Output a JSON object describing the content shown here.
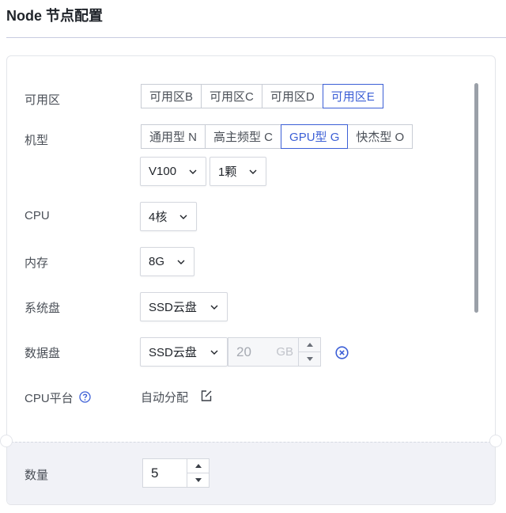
{
  "header": {
    "title": "Node 节点配置"
  },
  "zone": {
    "label": "可用区",
    "options": [
      "可用区B",
      "可用区C",
      "可用区D",
      "可用区E"
    ],
    "selected": "可用区E"
  },
  "instance_type": {
    "label": "机型",
    "options": [
      "通用型 N",
      "高主频型 C",
      "GPU型 G",
      "快杰型 O"
    ],
    "selected": "GPU型 G",
    "gpu_model": "V100",
    "gpu_count": "1颗"
  },
  "cpu": {
    "label": "CPU",
    "value": "4核"
  },
  "memory": {
    "label": "内存",
    "value": "8G"
  },
  "system_disk": {
    "label": "系统盘",
    "type": "SSD云盘"
  },
  "data_disk": {
    "label": "数据盘",
    "type": "SSD云盘",
    "size": "20",
    "unit": "GB"
  },
  "cpu_platform": {
    "label": "CPU平台",
    "value": "自动分配"
  },
  "quantity": {
    "label": "数量",
    "value": "5"
  },
  "colors": {
    "accent": "#3c5fd6",
    "text": "#1f2329",
    "muted": "#4a4f57"
  },
  "icons": [
    "chevron-down-icon",
    "question-circle-icon",
    "edit-icon",
    "close-circle-icon",
    "caret-up-icon",
    "caret-down-icon"
  ]
}
